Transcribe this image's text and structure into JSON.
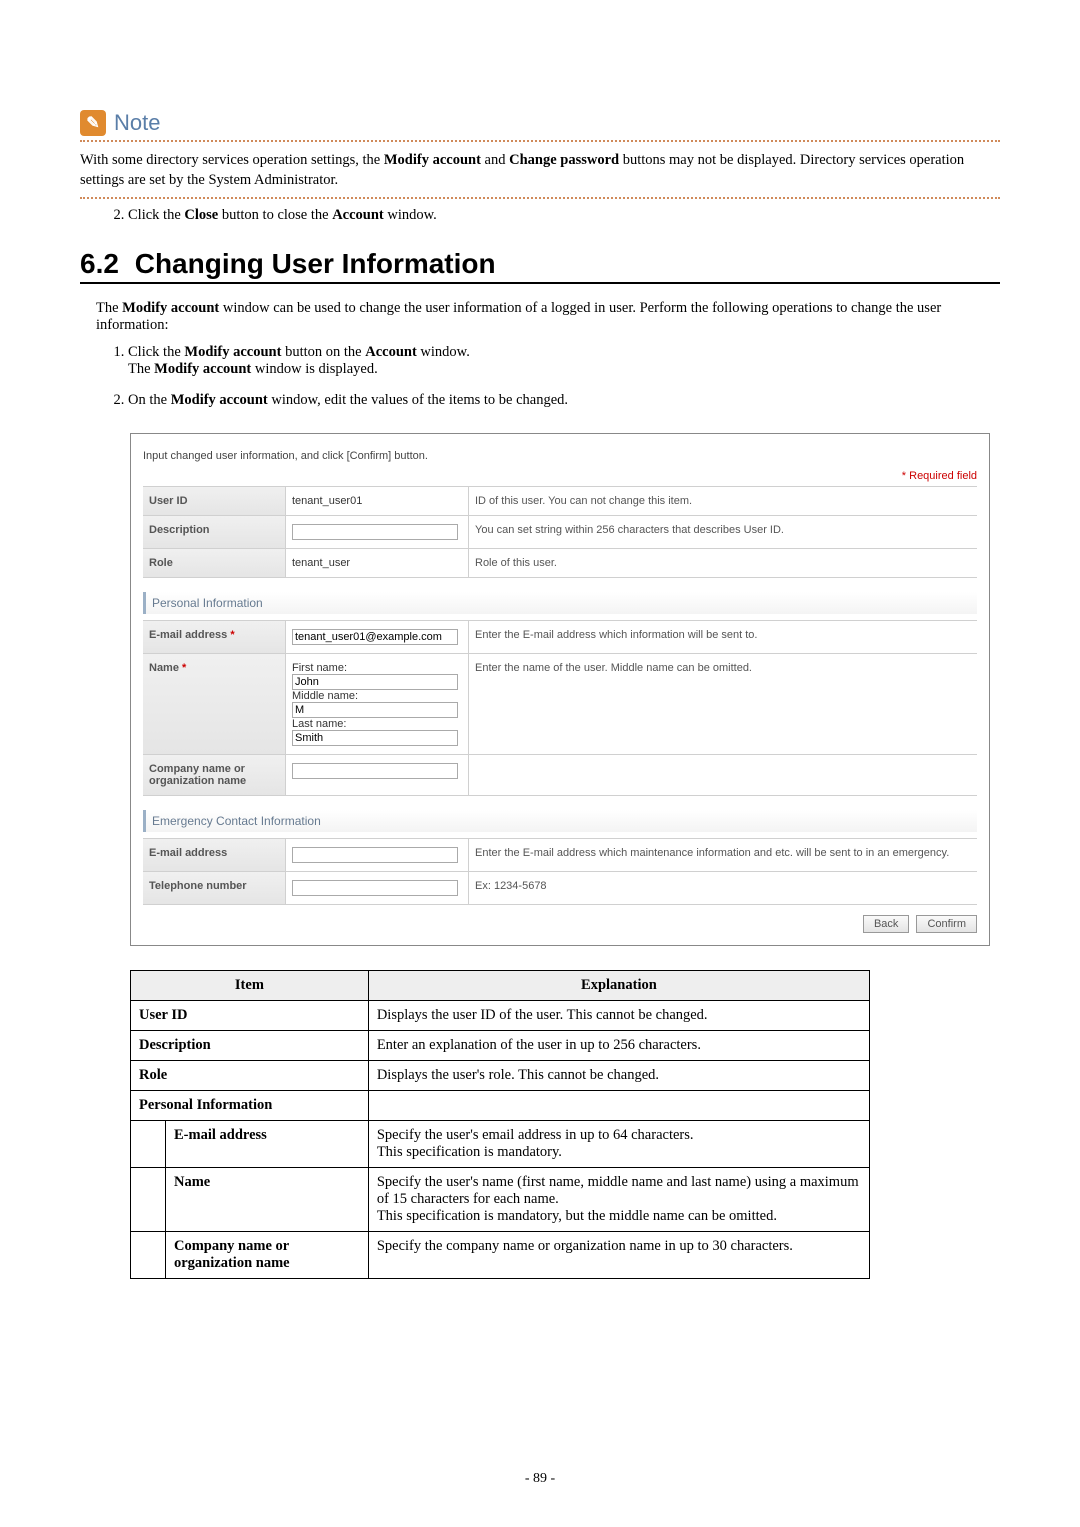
{
  "note": {
    "label": "Note",
    "body_pre": "With some directory services operation settings, the ",
    "body_b1": "Modify account",
    "body_mid": " and ",
    "body_b2": "Change password",
    "body_post": " buttons may not be displayed. Directory services operation settings are set by the System Administrator."
  },
  "step_close": {
    "pre": "Click the ",
    "b1": "Close",
    "mid": " button to close the ",
    "b2": "Account",
    "post": " window."
  },
  "section": {
    "num": "6.2",
    "title": "Changing User Information"
  },
  "intro": {
    "pre": "The ",
    "b1": "Modify account",
    "post": " window can be used to change the user information of a logged in user. Perform the following operations to change the user information:"
  },
  "steps": {
    "s1": {
      "pre": "Click the ",
      "b1": "Modify account",
      "mid": " button on the ",
      "b2": "Account",
      "post": " window.",
      "line2_pre": "The ",
      "line2_b": "Modify account",
      "line2_post": " window is displayed."
    },
    "s2": {
      "pre": "On the ",
      "b1": "Modify account",
      "post": " window, edit the values of the items to be changed."
    }
  },
  "shot": {
    "hint": "Input changed user information, and click [Confirm] button.",
    "required": "Required field",
    "rows": {
      "userid": {
        "label": "User ID",
        "value": "tenant_user01",
        "desc": "ID of this user. You can not change this item."
      },
      "desc": {
        "label": "Description",
        "desc": "You can set string within 256 characters that describes User ID."
      },
      "role": {
        "label": "Role",
        "value": "tenant_user",
        "desc": "Role of this user."
      }
    },
    "personal_title": "Personal Information",
    "personal": {
      "email": {
        "label": "E-mail address",
        "value": "tenant_user01@example.com",
        "desc": "Enter the E-mail address which information will be sent to."
      },
      "name": {
        "label": "Name",
        "first_l": "First name:",
        "first_v": "John",
        "mid_l": "Middle name:",
        "mid_v": "M",
        "last_l": "Last name:",
        "last_v": "Smith",
        "desc": "Enter the name of the user. Middle name can be omitted."
      },
      "company": {
        "label": "Company name or organization name"
      }
    },
    "emerg_title": "Emergency Contact Information",
    "emerg": {
      "email": {
        "label": "E-mail address",
        "desc": "Enter the E-mail address which maintenance information and etc. will be sent to in an emergency."
      },
      "tel": {
        "label": "Telephone number",
        "desc": "Ex: 1234-5678"
      }
    },
    "btn_back": "Back",
    "btn_confirm": "Confirm"
  },
  "table": {
    "head_item": "Item",
    "head_expl": "Explanation",
    "rows": {
      "userid": {
        "item": "User ID",
        "expl": "Displays the user ID of the user. This cannot be changed."
      },
      "desc": {
        "item": "Description",
        "expl": "Enter an explanation of the user in up to 256 characters."
      },
      "role": {
        "item": "Role",
        "expl": "Displays the user's role. This cannot be changed."
      },
      "pi": {
        "item": "Personal Information",
        "expl": ""
      },
      "email": {
        "item": "E-mail address",
        "expl": "Specify the user's email address in up to 64 characters.\nThis specification is mandatory."
      },
      "name": {
        "item": "Name",
        "expl": "Specify the user's name (first name, middle name and last name) using a maximum of 15 characters for each name.\nThis specification is mandatory, but the middle name can be omitted."
      },
      "company": {
        "item": "Company name or organization name",
        "expl": "Specify the company name or organization name in up to 30 characters."
      }
    }
  },
  "page_number": "- 89 -"
}
